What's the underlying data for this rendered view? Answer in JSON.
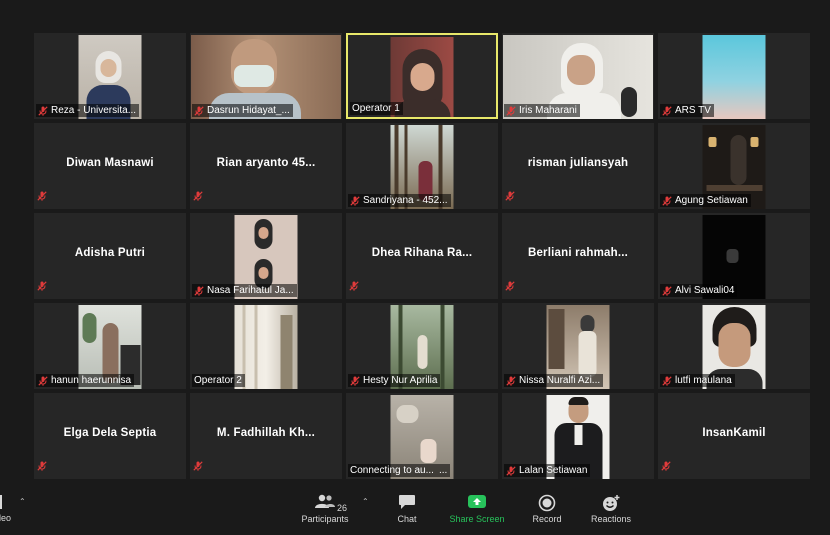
{
  "participants": [
    {
      "name": "Reza - Universita...",
      "video": "person-hijab-white",
      "muted": true
    },
    {
      "name": "Dasrun Hidayat_...",
      "video": "man-mask-wide",
      "muted": true
    },
    {
      "name": "Operator 1",
      "video": "person-hijab-dark",
      "muted": false,
      "active": true
    },
    {
      "name": "Iris Maharani",
      "video": "person-hijab-wide",
      "muted": true
    },
    {
      "name": "ARS TV",
      "video": "sky-gradient",
      "muted": true
    },
    {
      "name": "Diwan Masnawi",
      "video": null,
      "muted": true
    },
    {
      "name": "Rian aryanto 45...",
      "video": null,
      "muted": true
    },
    {
      "name": "Sandriyana - 452...",
      "video": "forest",
      "muted": true
    },
    {
      "name": "risman juliansyah",
      "video": null,
      "muted": true
    },
    {
      "name": "Agung Setiawan",
      "video": "dark-room",
      "muted": true
    },
    {
      "name": "Adisha Putri",
      "video": null,
      "muted": true
    },
    {
      "name": "Nasa Farihatul Ja...",
      "video": "two-people",
      "muted": true
    },
    {
      "name": "Dhea Rihana Ra...",
      "video": null,
      "muted": true
    },
    {
      "name": "Berliani rahmah...",
      "video": null,
      "muted": true
    },
    {
      "name": "Alvi Sawali04",
      "video": "black",
      "muted": true
    },
    {
      "name": "hanun haerunnisa",
      "video": "room-plant",
      "muted": true
    },
    {
      "name": "Operator 2",
      "video": "window-curtain",
      "muted": false
    },
    {
      "name": "Hesty Nur Aprilia",
      "video": "path-trees",
      "muted": true
    },
    {
      "name": "Nissa Nuralfi Azi...",
      "video": "cafe",
      "muted": true
    },
    {
      "name": "lutfi maulana",
      "video": "man-face",
      "muted": true
    },
    {
      "name": "Elga Dela Septia",
      "video": null,
      "muted": true
    },
    {
      "name": "M. Fadhillah Kh...",
      "video": null,
      "muted": true
    },
    {
      "name": "Connecting to au...",
      "video": "rocks",
      "muted": false,
      "extra": "..."
    },
    {
      "name": "Lalan Setiawan",
      "video": "man-suit",
      "muted": true
    },
    {
      "name": "InsanKamil",
      "video": null,
      "muted": true
    }
  ],
  "toolbar": {
    "video_label": "ideo",
    "participants_label": "Participants",
    "participants_count": "26",
    "chat_label": "Chat",
    "share_label": "Share Screen",
    "record_label": "Record",
    "reactions_label": "Reactions"
  },
  "icons": {
    "mute": "mic-muted-icon",
    "participants": "participants-icon",
    "chat": "chat-icon",
    "share": "share-screen-icon",
    "record": "record-icon",
    "reactions": "reactions-icon"
  },
  "colors": {
    "background": "#1a1a1a",
    "tile": "#262626",
    "active_border": "#e8e86a",
    "mute_red": "#e03b3b",
    "share_green": "#27c25b"
  }
}
